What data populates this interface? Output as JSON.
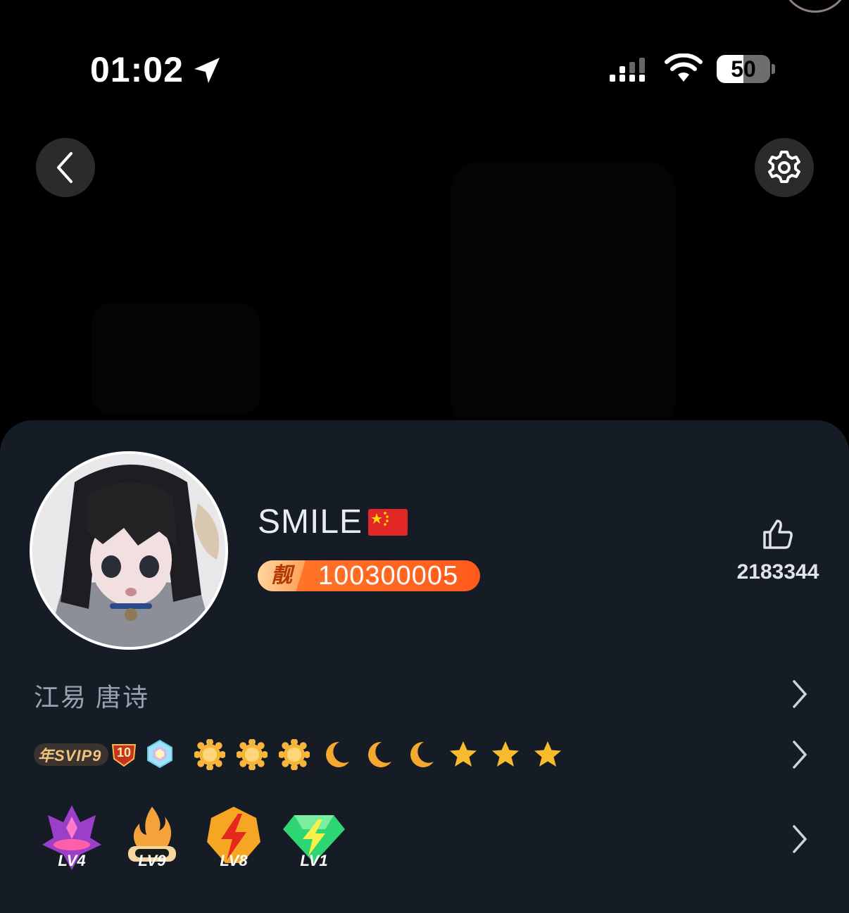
{
  "status_bar": {
    "time": "01:02",
    "battery": "50",
    "battery_level": 0.5
  },
  "profile": {
    "username": "SMILE",
    "flag_icon": "china-flag-icon",
    "id_tag": "靓",
    "id_number": "100300005",
    "likes": "2183344",
    "bio": "江易 唐诗"
  },
  "badges": {
    "svip_label": "年SVIP9",
    "svip_sub": "10",
    "level_icons": [
      "sun-icon",
      "sun-icon",
      "sun-icon",
      "moon-icon",
      "moon-icon",
      "moon-icon",
      "star-icon",
      "star-icon",
      "star-icon"
    ],
    "level_badges": [
      {
        "icon": "crown-purple-icon",
        "label": "LV4"
      },
      {
        "icon": "flame-icon",
        "label": "LV9"
      },
      {
        "icon": "lightning-icon",
        "label": "LV8"
      },
      {
        "icon": "diamond-lightning-icon",
        "label": "LV1"
      }
    ]
  },
  "colors": {
    "card_bg": "#161c26",
    "id_badge": "#ff6a22",
    "sun": "#f6b63a",
    "moon": "#f4a830",
    "star": "#f7bb2c"
  }
}
